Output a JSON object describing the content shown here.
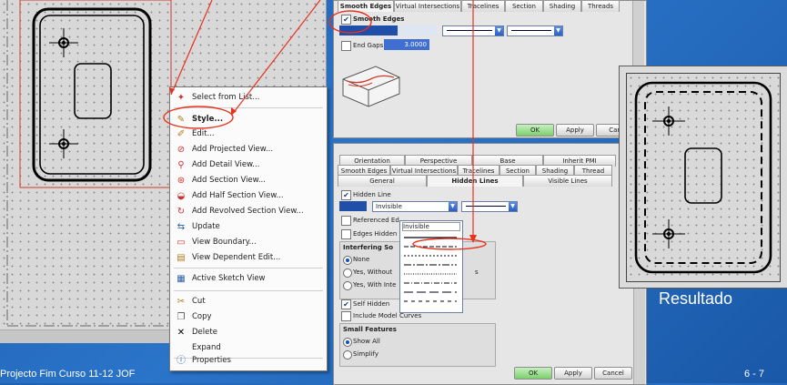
{
  "context_menu": {
    "items": [
      {
        "icon": "select-list-icon",
        "label": "Select from List..."
      },
      {
        "icon": "style-icon",
        "label": "Style..."
      },
      {
        "icon": "edit-icon",
        "label": "Edit..."
      },
      {
        "icon": "projected-view-icon",
        "label": "Add Projected View..."
      },
      {
        "icon": "detail-view-icon",
        "label": "Add Detail View..."
      },
      {
        "icon": "section-view-icon",
        "label": "Add Section View..."
      },
      {
        "icon": "half-section-icon",
        "label": "Add Half Section View..."
      },
      {
        "icon": "revolved-section-icon",
        "label": "Add Revolved Section View..."
      },
      {
        "icon": "update-icon",
        "label": "Update"
      },
      {
        "icon": "view-boundary-icon",
        "label": "View Boundary..."
      },
      {
        "icon": "view-dependent-edit-icon",
        "label": "View Dependent Edit..."
      },
      {
        "icon": "active-sketch-icon",
        "label": "Active Sketch View"
      },
      {
        "icon": "cut-icon",
        "label": "Cut"
      },
      {
        "icon": "copy-icon",
        "label": "Copy"
      },
      {
        "icon": "delete-icon",
        "label": "Delete"
      },
      {
        "icon": "",
        "label": "Expand"
      },
      {
        "icon": "properties-icon",
        "label": "Properties"
      }
    ]
  },
  "dialog_top": {
    "tabs": [
      "Smooth Edges",
      "Virtual Intersections",
      "Tracelines",
      "Section",
      "Shading",
      "Threads"
    ],
    "smooth_edges_label": "Smooth Edges",
    "end_gaps_label": "End Gaps",
    "end_gaps_value": "3.0000",
    "ok": "OK",
    "apply": "Apply",
    "cancel": "Can"
  },
  "dialog_bottom": {
    "tabs_row1": [
      "Orientation",
      "Perspective",
      "Base",
      "Inherit PMI"
    ],
    "tabs_row2": [
      "Smooth Edges",
      "Virtual Intersections",
      "Tracelines",
      "Section",
      "Shading",
      "Thread"
    ],
    "tabs_row3": [
      "General",
      "Hidden Lines",
      "Visible Lines"
    ],
    "hidden_line_label": "Hidden Line",
    "font_value": "Invisible",
    "dropdown_first": "Invisible",
    "referenced_edges": "Referenced Ed",
    "edges_hidden": "Edges Hidden",
    "interfering_title": "Interfering So",
    "opt_none": "None",
    "opt_yes_without": "Yes, Without",
    "opt_yes_with": "Yes, With Inte",
    "opt_trail": "s",
    "self_hidden": "Self Hidden",
    "include_model_curves": "Include Model Curves",
    "small_features": "Small Features",
    "show_all": "Show All",
    "simplify": "Simplify",
    "ok": "OK",
    "apply": "Apply",
    "cancel": "Cancel"
  },
  "result_label": "Resultado",
  "footer": {
    "left": "Projecto Fim Curso 11-12 JOF",
    "right": "6 - 7"
  },
  "colors": {
    "annotation_red": "#e8321e",
    "background_blue": "#2368bd"
  }
}
